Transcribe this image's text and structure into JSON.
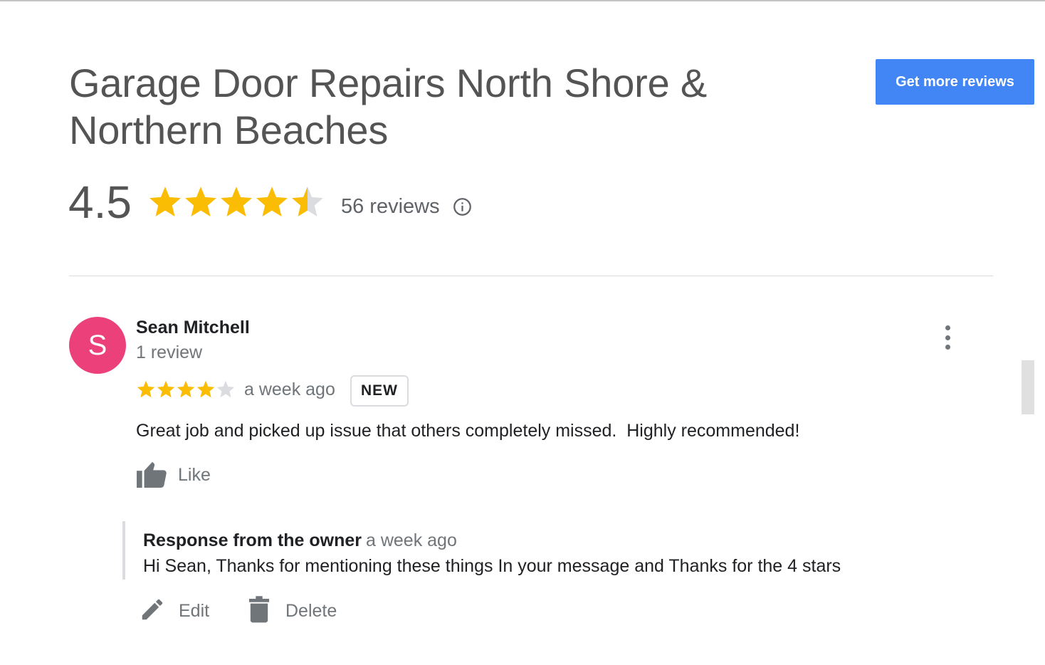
{
  "business": {
    "title_line1": "Garage Door Repairs North Shore &",
    "title_line2": "Northern Beaches",
    "get_more_label": "Get more reviews",
    "rating_value": "4.5",
    "rating_numeric": 4.5,
    "review_count_label": "56 reviews",
    "info_icon": "info-circle-icon"
  },
  "colors": {
    "star_filled": "#fbbc04",
    "star_empty": "#dadce0",
    "primary_button": "#4285f4",
    "avatar_bg": "#ec407a"
  },
  "review": {
    "avatar_letter": "S",
    "reviewer_name": "Sean Mitchell",
    "reviewer_sub": "1 review",
    "rating": 4,
    "rating_max": 5,
    "time": "a week ago",
    "badge": "NEW",
    "text": "Great job and picked up issue that others completely missed.  Highly recommended!",
    "like_label": "Like",
    "menu_icon": "more-vertical-icon"
  },
  "response": {
    "title": "Response from the owner",
    "time": "a week ago",
    "text": "Hi Sean, Thanks for mentioning these things In your message and Thanks for the 4 stars",
    "edit_label": "Edit",
    "delete_label": "Delete"
  }
}
